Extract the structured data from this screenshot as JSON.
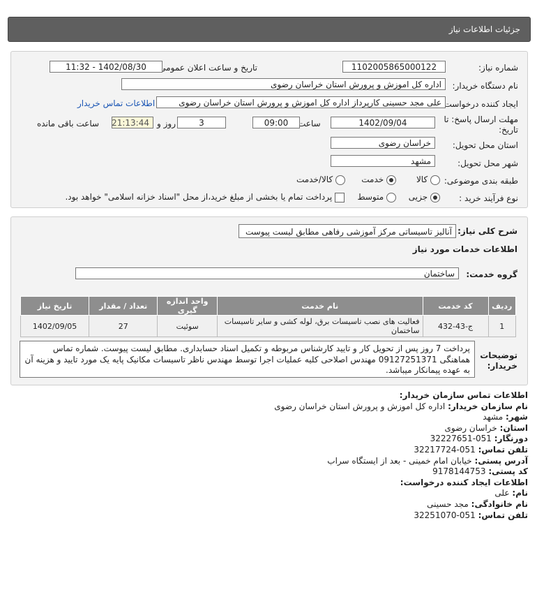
{
  "header": {
    "title": "جزئیات اطلاعات نیاز"
  },
  "info": {
    "need_number_label": "شماره نیاز:",
    "need_number": "1102005865000122",
    "announce_label": "تاریخ و ساعت اعلان عمومی:",
    "announce_value": "1402/08/30 - 11:32",
    "buyer_org_label": "نام دستگاه خریدار:",
    "buyer_org": "اداره کل اموزش و پرورش استان خراسان رضوی",
    "requester_label": "ایجاد کننده درخواست:",
    "requester": "علی مجد حسینی کارپرداز اداره کل اموزش و پرورش استان خراسان رضوی",
    "contact_link": "اطلاعات تماس خریدار",
    "deadline_label_1": "مهلت ارسال پاسخ: تا",
    "deadline_label_2": "تاریخ:",
    "deadline_date": "1402/09/04",
    "time_label": "ساعت",
    "deadline_time": "09:00",
    "days_value": "3",
    "days_label": "روز و",
    "remaining_time": "21:13:44",
    "remaining_label": "ساعت باقی مانده",
    "province_label": "استان محل تحویل:",
    "province": "خراسان رضوی",
    "city_label": "شهر محل تحویل:",
    "city": "مشهد",
    "category_label": "طبقه بندی موضوعی:",
    "category_options": [
      "کالا",
      "خدمت",
      "کالا/خدمت"
    ],
    "process_label": "نوع فرآیند خرید :",
    "process_options": [
      "جزیی",
      "متوسط"
    ],
    "payment_note": "پرداخت تمام یا بخشی از مبلغ خرید،از محل \"اسناد خزانه اسلامی\" خواهد بود."
  },
  "desc": {
    "summary_label": "شرح کلی نیاز:",
    "summary": "آنالیز تاسیساتی مرکز آموزشی رفاهی مطابق لیست پیوست",
    "services_heading": "اطلاعات خدمات مورد نیاز",
    "service_group_label": "گروه خدمت:",
    "service_group": "ساختمان",
    "table": {
      "headers": [
        "ردیف",
        "کد خدمت",
        "نام خدمت",
        "واحد اندازه گیری",
        "تعداد / مقدار",
        "تاریخ نیاز"
      ],
      "rows": [
        [
          "1",
          "ج-43-432",
          "فعالیت های نصب تاسیسات برق، لوله کشی و سایر تاسیسات ساختمان",
          "سوئیت",
          "27",
          "1402/09/05"
        ]
      ]
    },
    "buyer_notes_label_1": "توضیحات",
    "buyer_notes_label_2": "خریدار:",
    "buyer_notes": "پرداخت 7 روز پس از تحویل کار و تایید کارشناس مربوطه و تکمیل اسناد حسابداری. مطابق لیست پیوست. شماره تماس هماهنگی 09127251371 مهندس اصلاحی کلیه عملیات اجرا توسط مهندس ناظر تاسیسات مکانیک پایه یک مورد تایید و هزینه آن به عهده پیمانکار میباشد."
  },
  "contact": {
    "heading": "اطلاعات تماس سازمان خریدار:",
    "org_label": "نام سازمان خریدار:",
    "org": "اداره کل اموزش و پرورش استان خراسان رضوی",
    "city_label": "شهر:",
    "city": "مشهد",
    "province_label": "استان:",
    "province": "خراسان رضوی",
    "fax_label": "دورنگار:",
    "fax": "051-32227651",
    "phone_label": "تلفن تماس:",
    "phone": "051-32217724",
    "address_label": "آدرس پستی:",
    "address": "خیابان امام خمینی - بعد از ایستگاه سراب",
    "postal_label": "کد پستی:",
    "postal": "9178144753",
    "creator_heading": "اطلاعات ایجاد کننده درخواست:",
    "first_name_label": "نام:",
    "first_name": "علی",
    "last_name_label": "نام خانوادگی:",
    "last_name": "مجد حسینی",
    "creator_phone_label": "تلفن تماس:",
    "creator_phone": "051-32251070"
  }
}
